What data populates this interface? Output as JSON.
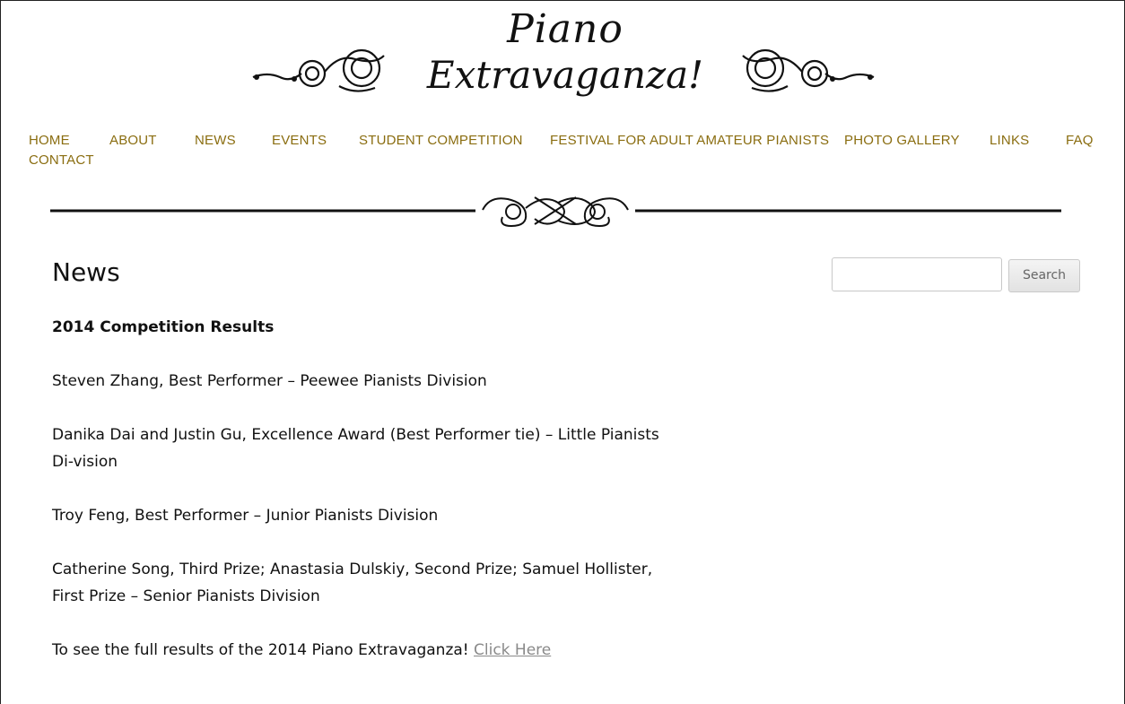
{
  "site": {
    "logo_line1": "Piano",
    "logo_line2": "Extravaganza!"
  },
  "nav": {
    "items": [
      {
        "label": "HOME"
      },
      {
        "label": "ABOUT"
      },
      {
        "label": "NEWS"
      },
      {
        "label": "EVENTS"
      },
      {
        "label": "STUDENT COMPETITION"
      },
      {
        "label": "FESTIVAL FOR ADULT AMATEUR PIANISTS"
      },
      {
        "label": "PHOTO GALLERY"
      },
      {
        "label": "LINKS"
      },
      {
        "label": "FAQ"
      },
      {
        "label": "CONTACT"
      }
    ]
  },
  "page": {
    "title": "News",
    "heading": "2014 Competition Results",
    "paragraphs": [
      "Steven Zhang, Best Performer – Peewee Pianists Division",
      "Danika Dai and Justin Gu, Excellence Award (Best Performer tie) – Little Pianists Di-vision",
      "Troy Feng, Best Performer – Junior Pianists Division",
      "Catherine Song, Third Prize; Anastasia Dulskiy, Second Prize; Samuel Hollister, First Prize – Senior Pianists Division"
    ],
    "cta_text": "To see the full results of the 2014 Piano Extravaganza! ",
    "cta_link": "Click Here"
  },
  "search": {
    "placeholder": "",
    "button_label": "Search"
  },
  "colors": {
    "nav": "#8a6d10",
    "link": "#8a8a8a"
  }
}
